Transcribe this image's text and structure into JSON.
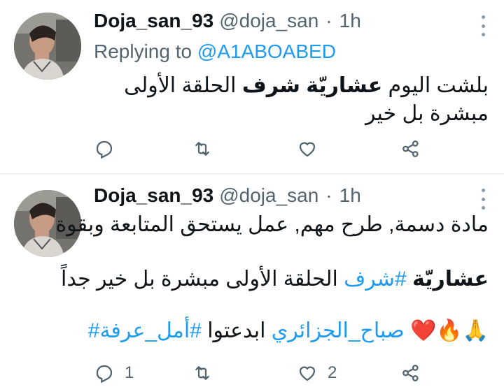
{
  "tweets": [
    {
      "name": "Doja_san_93",
      "handle": "@doja_san",
      "separator": "·",
      "time": "1h",
      "replying_prefix": "Replying to",
      "replying_to": "@A1ABOABED",
      "text_pre": "بلشت اليوم ",
      "text_bold": "عشاريّة شرف",
      "text_post": " الحلقة الأولى مبشرة بل خير",
      "counts": {
        "reply": "",
        "retweet": "",
        "like": ""
      }
    },
    {
      "name": "Doja_san_93",
      "handle": "@doja_san",
      "separator": "·",
      "time": "1h",
      "line1": "مادة دسمة, طرح مهم, عمل يستحق المتابعة وبقوة",
      "line2_bold": "عشاريّة",
      "line2_hashtag": "#شرف",
      "line2_rest": " الحلقة الأولى مبشرة بل خير جداً",
      "line3_emoji": "🙏🔥❤️",
      "line3_tag1": "صباح_الجزائري",
      "line3_mid": " ابدعتوا",
      "line3_tag2": "#أمل_عرفة#",
      "counts": {
        "reply": "1",
        "retweet": "",
        "like": "2"
      }
    }
  ],
  "icons": {
    "reply": "reply-icon",
    "retweet": "retweet-icon",
    "like": "heart-icon",
    "share": "share-icon",
    "more": "more-icon"
  },
  "colors": {
    "accent": "#1d9bf0",
    "muted": "#536471",
    "text": "#0f1419"
  }
}
